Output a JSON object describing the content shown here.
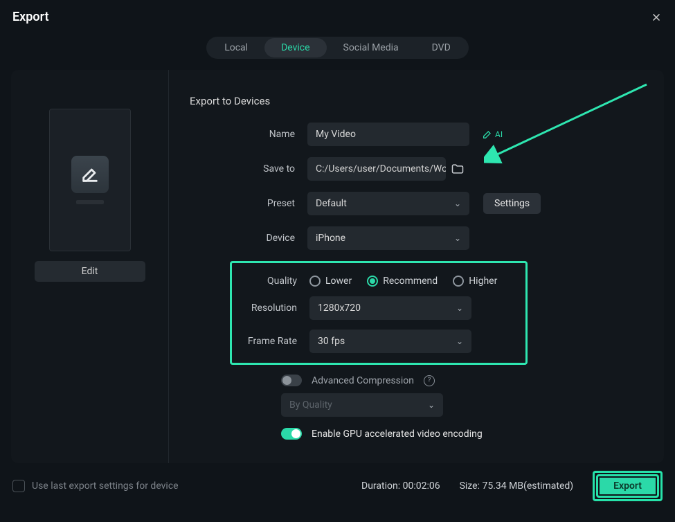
{
  "title": "Export",
  "tabs": {
    "local": "Local",
    "device": "Device",
    "social": "Social Media",
    "dvd": "DVD"
  },
  "section_title": "Export to Devices",
  "labels": {
    "name": "Name",
    "save_to": "Save to",
    "preset": "Preset",
    "device": "Device",
    "quality": "Quality",
    "resolution": "Resolution",
    "frame_rate": "Frame Rate",
    "advanced": "Advanced Compression",
    "gpu": "Enable GPU accelerated video encoding"
  },
  "values": {
    "name": "My Video",
    "save_to": "C:/Users/user/Documents/Wo",
    "preset": "Default",
    "device": "iPhone",
    "resolution": "1280x720",
    "frame_rate": "30 fps",
    "adv_mode": "By Quality"
  },
  "quality_options": {
    "lower": "Lower",
    "recommend": "Recommend",
    "higher": "Higher"
  },
  "buttons": {
    "edit": "Edit",
    "settings": "Settings",
    "export": "Export",
    "ai": "AI"
  },
  "footer": {
    "use_last": "Use last export settings for device",
    "duration_label": "Duration:",
    "duration": "00:02:06",
    "size_label": "Size:",
    "size": "75.34 MB",
    "estimated": "(estimated)"
  }
}
